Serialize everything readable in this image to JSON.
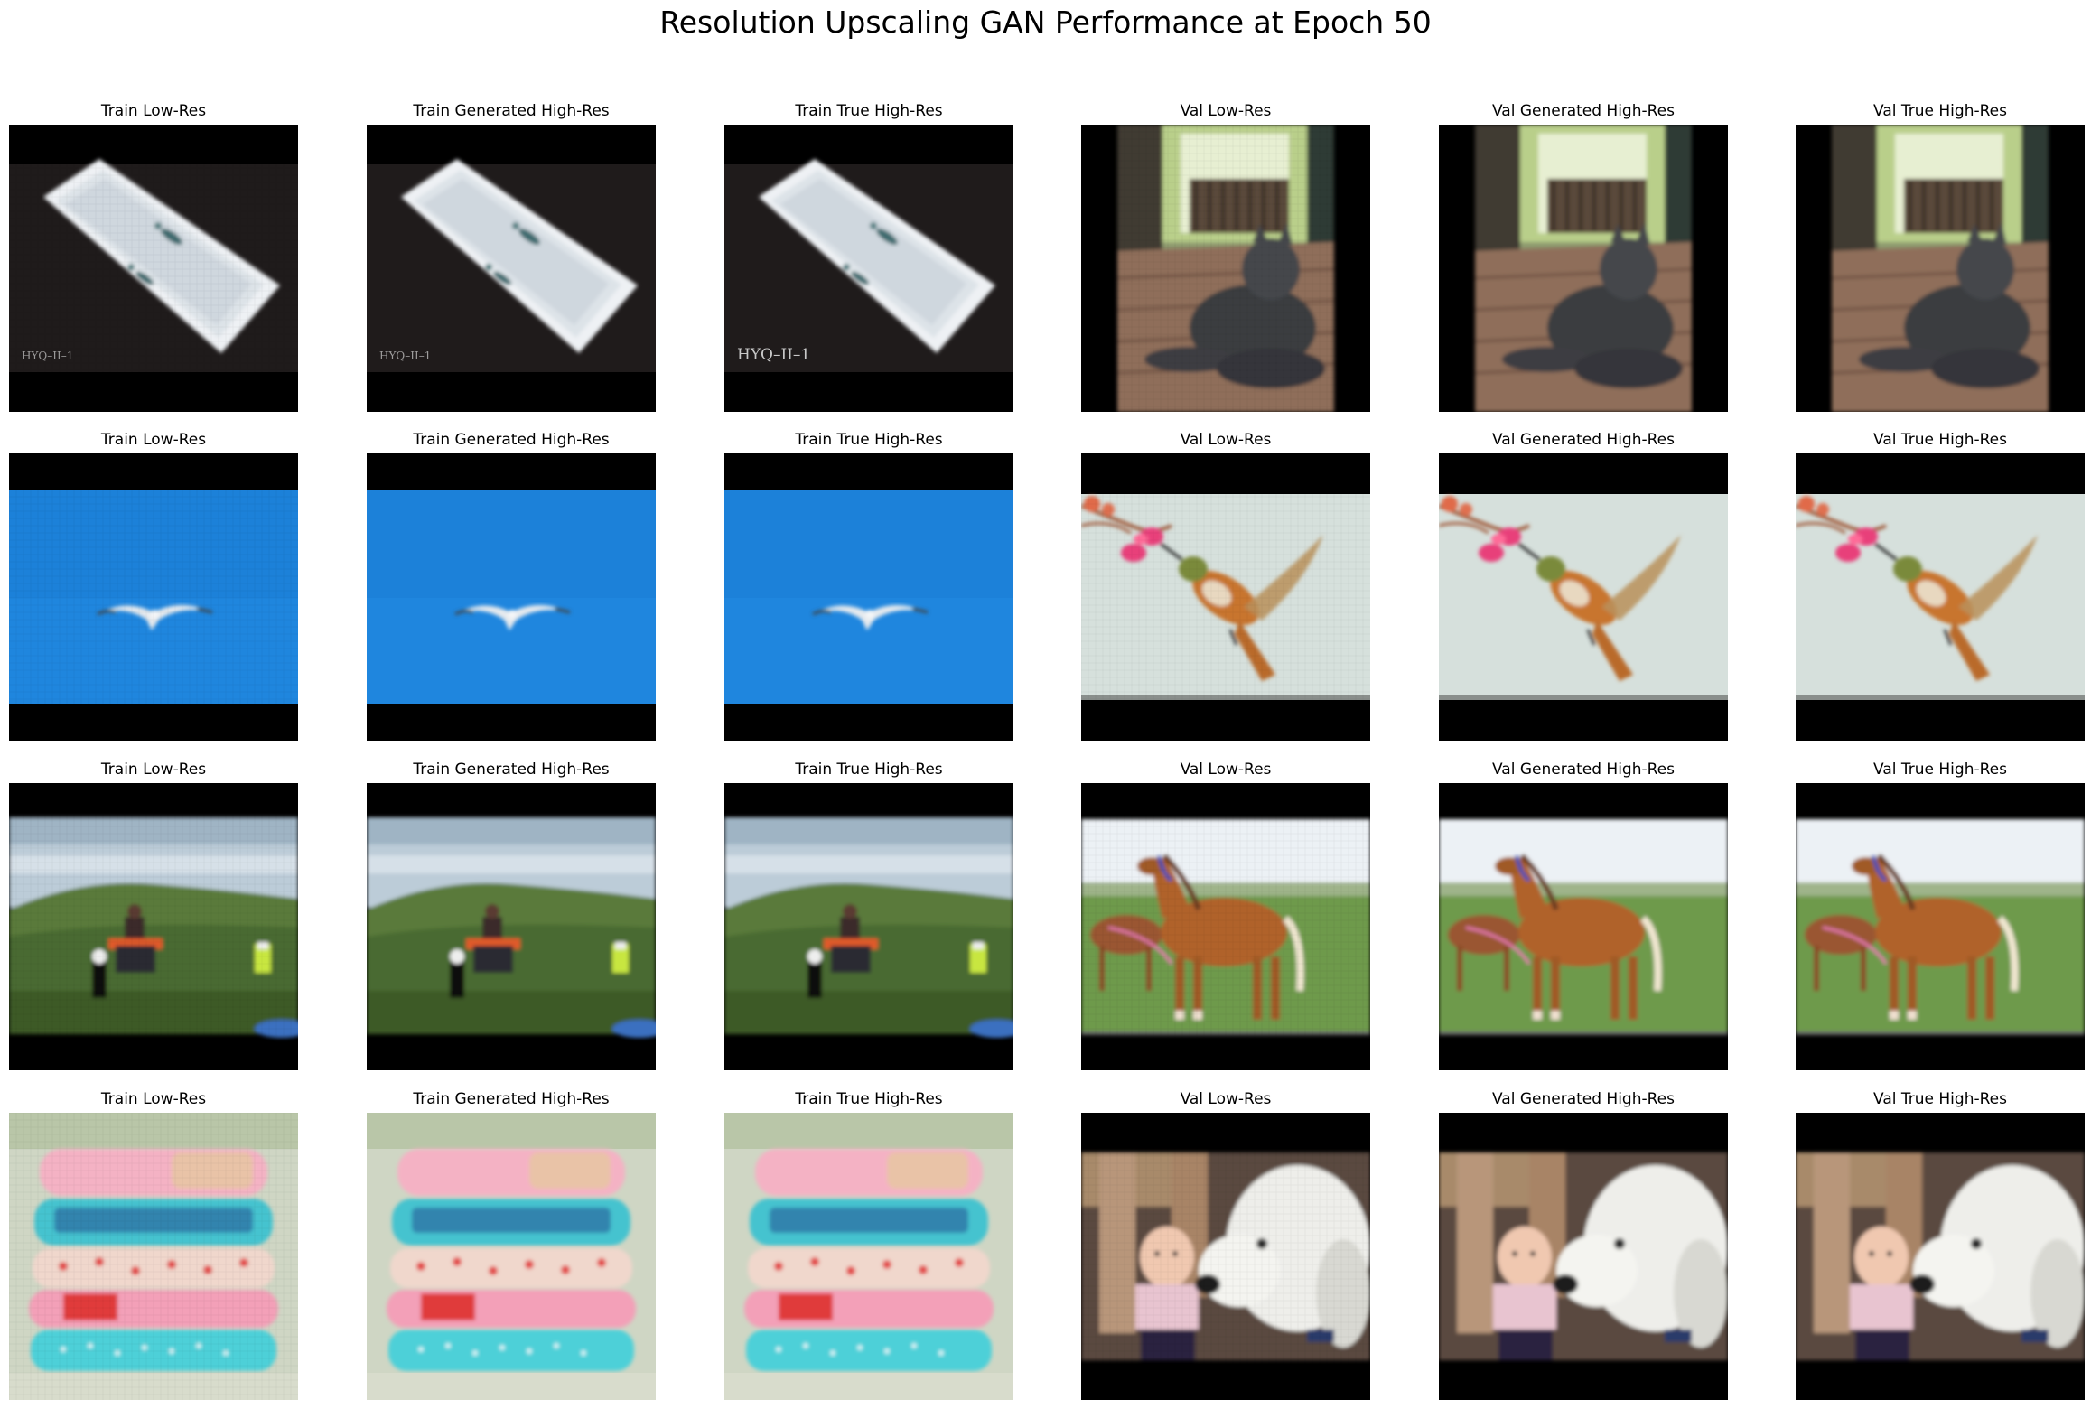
{
  "figure": {
    "title": "Resolution Upscaling GAN Performance at Epoch 50"
  },
  "rows": [
    {
      "scene": "bathtub",
      "panels": [
        {
          "title": "Train Low-Res",
          "caption_text": "HYQ–II–1",
          "quality": "low"
        },
        {
          "title": "Train Generated High-Res",
          "caption_text": "HYQ–II–1",
          "quality": "gen"
        },
        {
          "title": "Train True High-Res",
          "caption_text": "HYQ–II–1",
          "quality": "true"
        },
        {
          "title": "Val Low-Res",
          "quality": "low"
        },
        {
          "title": "Val Generated High-Res",
          "quality": "gen"
        },
        {
          "title": "Val True High-Res",
          "quality": "true"
        }
      ],
      "val_scene": "cat-porch"
    },
    {
      "scene": "seagull-sky",
      "panels": [
        {
          "title": "Train Low-Res",
          "quality": "low"
        },
        {
          "title": "Train Generated High-Res",
          "quality": "gen"
        },
        {
          "title": "Train True High-Res",
          "quality": "true"
        },
        {
          "title": "Val Low-Res",
          "quality": "low"
        },
        {
          "title": "Val Generated High-Res",
          "quality": "gen"
        },
        {
          "title": "Val True High-Res",
          "quality": "true"
        }
      ],
      "val_scene": "hummingbird-flower"
    },
    {
      "scene": "field-people",
      "panels": [
        {
          "title": "Train Low-Res",
          "quality": "low"
        },
        {
          "title": "Train Generated High-Res",
          "quality": "gen"
        },
        {
          "title": "Train True High-Res",
          "quality": "true"
        },
        {
          "title": "Val Low-Res",
          "quality": "low"
        },
        {
          "title": "Val Generated High-Res",
          "quality": "gen"
        },
        {
          "title": "Val True High-Res",
          "quality": "true"
        }
      ],
      "val_scene": "horses-field"
    },
    {
      "scene": "pillow-stack",
      "panels": [
        {
          "title": "Train Low-Res",
          "quality": "low"
        },
        {
          "title": "Train Generated High-Res",
          "quality": "gen"
        },
        {
          "title": "Train True High-Res",
          "quality": "true"
        },
        {
          "title": "Val Low-Res",
          "quality": "low"
        },
        {
          "title": "Val Generated High-Res",
          "quality": "gen"
        },
        {
          "title": "Val True High-Res",
          "quality": "true"
        }
      ],
      "val_scene": "baby-dog"
    }
  ],
  "colors": {
    "sky_blue": "#1e88e0",
    "pad_black": "#000000",
    "grass_green": "#5a8a3c",
    "horse_brown": "#b0622a",
    "pillow_pink": "#f3aac0",
    "pillow_teal": "#45c3cf",
    "flower_pink": "#e8407a"
  }
}
